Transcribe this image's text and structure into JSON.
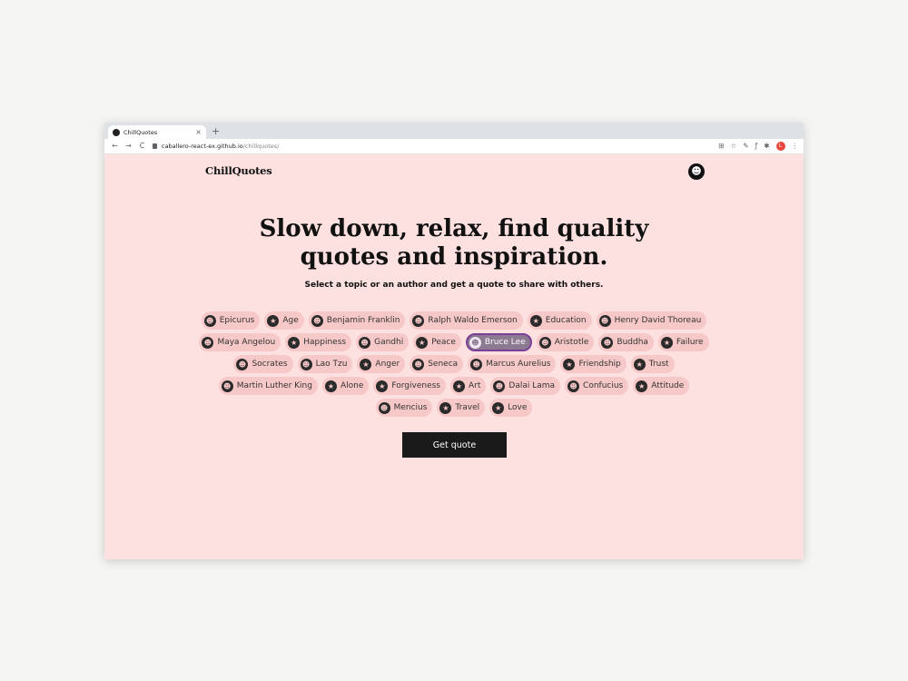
{
  "browser": {
    "tab_title": "ChillQuotes",
    "tab_close": "×",
    "new_tab": "+",
    "url_host": "caballero-react-ex.github.io",
    "url_path": "/chillquotes/",
    "nav": {
      "back": "←",
      "forward": "→",
      "reload": "C"
    },
    "toolbar_icons": [
      "translate-icon",
      "star-icon",
      "pen-icon",
      "function-icon",
      "puzzle-icon",
      "menu-icon"
    ],
    "profile_initial": "L"
  },
  "header": {
    "logo": "ChillQuotes",
    "smiley_glyph": "☻"
  },
  "hero": {
    "line1": "Slow down, relax, find quality",
    "line2": "quotes and inspiration.",
    "subtitle": "Select a topic or an author and get a quote to share with others."
  },
  "chip_icons": {
    "author": "☻",
    "topic": "★"
  },
  "topics": [
    [
      {
        "label": "Epicurus",
        "kind": "author"
      },
      {
        "label": "Age",
        "kind": "topic"
      },
      {
        "label": "Benjamin Franklin",
        "kind": "author"
      },
      {
        "label": "Ralph Waldo Emerson",
        "kind": "author"
      },
      {
        "label": "Education",
        "kind": "topic"
      },
      {
        "label": "Henry David Thoreau",
        "kind": "author"
      }
    ],
    [
      {
        "label": "Maya Angelou",
        "kind": "author"
      },
      {
        "label": "Happiness",
        "kind": "topic"
      },
      {
        "label": "Gandhi",
        "kind": "author"
      },
      {
        "label": "Peace",
        "kind": "topic"
      },
      {
        "label": "Bruce Lee",
        "kind": "author",
        "selected": true
      },
      {
        "label": "Aristotle",
        "kind": "author"
      },
      {
        "label": "Buddha",
        "kind": "author"
      },
      {
        "label": "Failure",
        "kind": "topic"
      }
    ],
    [
      {
        "label": "Socrates",
        "kind": "author"
      },
      {
        "label": "Lao Tzu",
        "kind": "author"
      },
      {
        "label": "Anger",
        "kind": "topic"
      },
      {
        "label": "Seneca",
        "kind": "author"
      },
      {
        "label": "Marcus Aurelius",
        "kind": "author"
      },
      {
        "label": "Friendship",
        "kind": "topic"
      },
      {
        "label": "Trust",
        "kind": "topic"
      }
    ],
    [
      {
        "label": "Martin Luther King",
        "kind": "author"
      },
      {
        "label": "Alone",
        "kind": "topic"
      },
      {
        "label": "Forgiveness",
        "kind": "topic"
      },
      {
        "label": "Art",
        "kind": "topic"
      },
      {
        "label": "Dalai Lama",
        "kind": "author"
      },
      {
        "label": "Confucius",
        "kind": "author"
      },
      {
        "label": "Attitude",
        "kind": "topic"
      }
    ],
    [
      {
        "label": "Mencius",
        "kind": "author"
      },
      {
        "label": "Travel",
        "kind": "topic"
      },
      {
        "label": "Love",
        "kind": "topic"
      }
    ]
  ],
  "cta": {
    "label": "Get quote"
  },
  "colors": {
    "page_bg": "#fde0e0",
    "chip_bg": "#f6c8c8",
    "selected_bg": "#8c7a93",
    "selected_border": "#7b3f95",
    "button_bg": "#1a1a1a"
  }
}
